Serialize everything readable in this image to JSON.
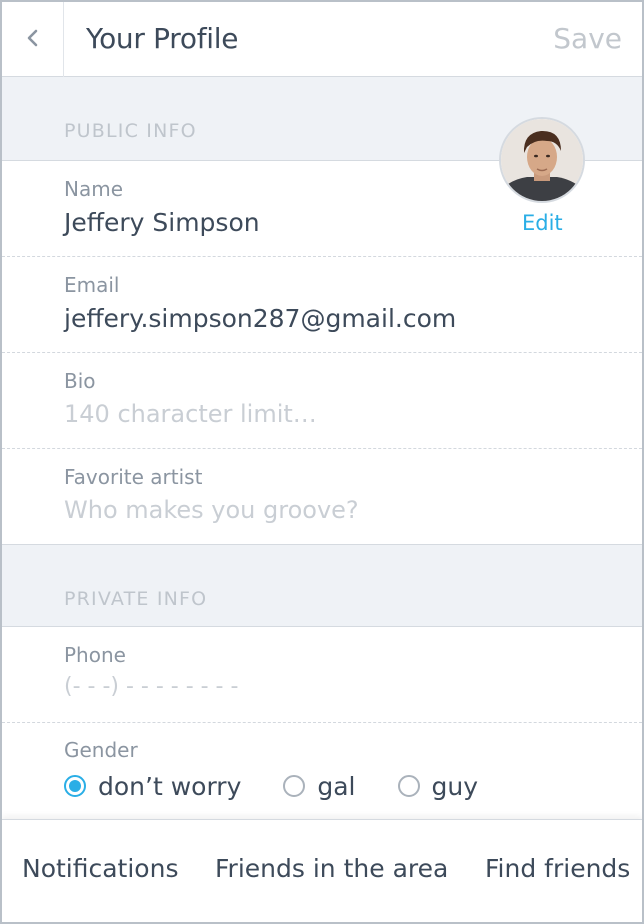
{
  "header": {
    "title": "Your Profile",
    "save_label": "Save",
    "back_icon": "chevron-left-icon"
  },
  "public_info": {
    "section_label": "PUBLIC INFO",
    "avatar": {
      "edit_label": "Edit"
    },
    "fields": [
      {
        "label": "Name",
        "value": "Jeffery Simpson"
      },
      {
        "label": "Email",
        "value": "jeffery.simpson287@gmail.com"
      },
      {
        "label": "Bio",
        "placeholder": "140 character limit…"
      },
      {
        "label": "Favorite artist",
        "placeholder": "Who makes you groove?"
      }
    ]
  },
  "private_info": {
    "section_label": "PRIVATE INFO",
    "phone": {
      "label": "Phone",
      "placeholder": "(- - -) - - -  -  - - - -"
    },
    "gender": {
      "label": "Gender",
      "options": [
        "don’t worry",
        "gal",
        "guy"
      ],
      "selected": "don’t worry"
    }
  },
  "bottom_nav": {
    "items": [
      "Notifications",
      "Friends in the area",
      "Find friends"
    ]
  },
  "colors": {
    "accent": "#2aaee6",
    "text": "#3d4a5a",
    "muted": "#8b95a1",
    "placeholder": "#c9ced4",
    "section_bg": "#eff2f6"
  }
}
